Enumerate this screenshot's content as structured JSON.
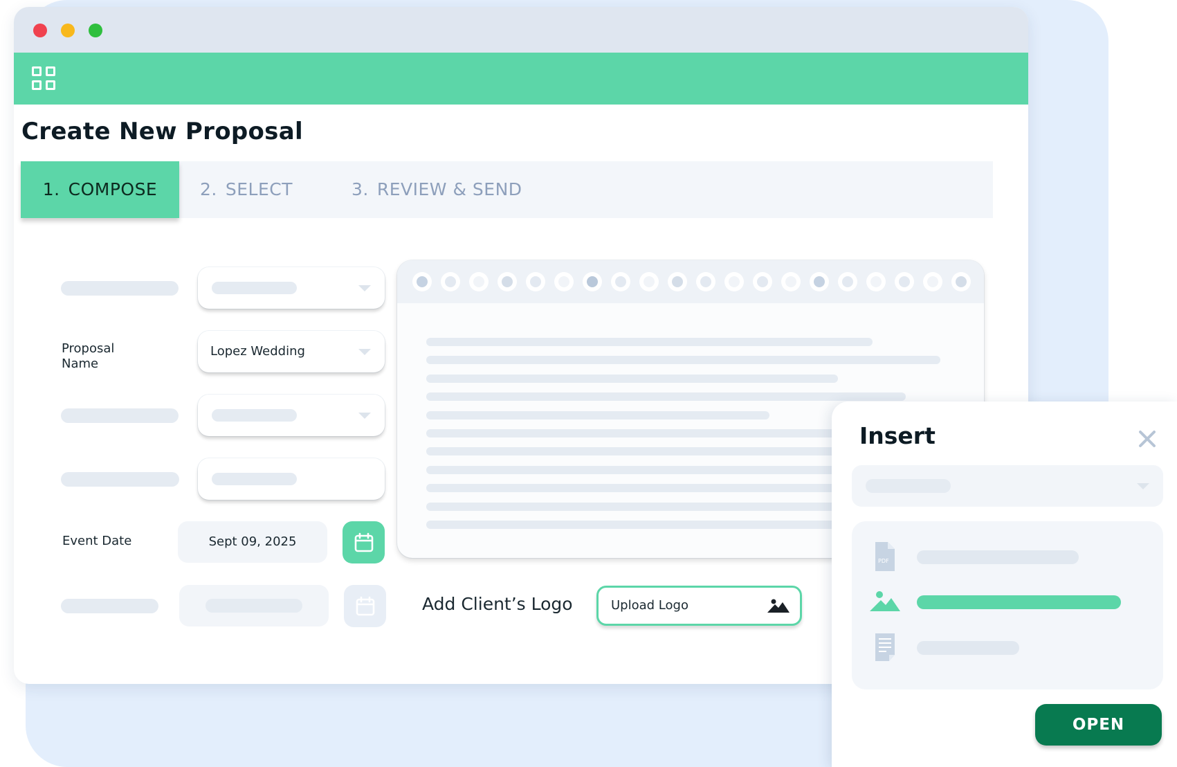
{
  "window": {
    "page_title": "Create New Proposal"
  },
  "steps": [
    {
      "num": "1.",
      "label": "COMPOSE",
      "active": true
    },
    {
      "num": "2.",
      "label": "SELECT",
      "active": false
    },
    {
      "num": "3.",
      "label": "REVIEW & SEND",
      "active": false
    }
  ],
  "form": {
    "proposal_name_label": "Proposal Name",
    "proposal_name_value": "Lopez Wedding",
    "event_date_label": "Event Date",
    "event_date_value": "Sept 09, 2025"
  },
  "logo": {
    "label": "Add Client’s Logo",
    "upload_label": "Upload Logo"
  },
  "insert": {
    "title": "Insert",
    "pdf_icon_text": "PDF",
    "open_label": "OPEN"
  },
  "colors": {
    "accent": "#5cd6a8",
    "accent_dark": "#087a50",
    "muted": "#8d9fbb"
  }
}
